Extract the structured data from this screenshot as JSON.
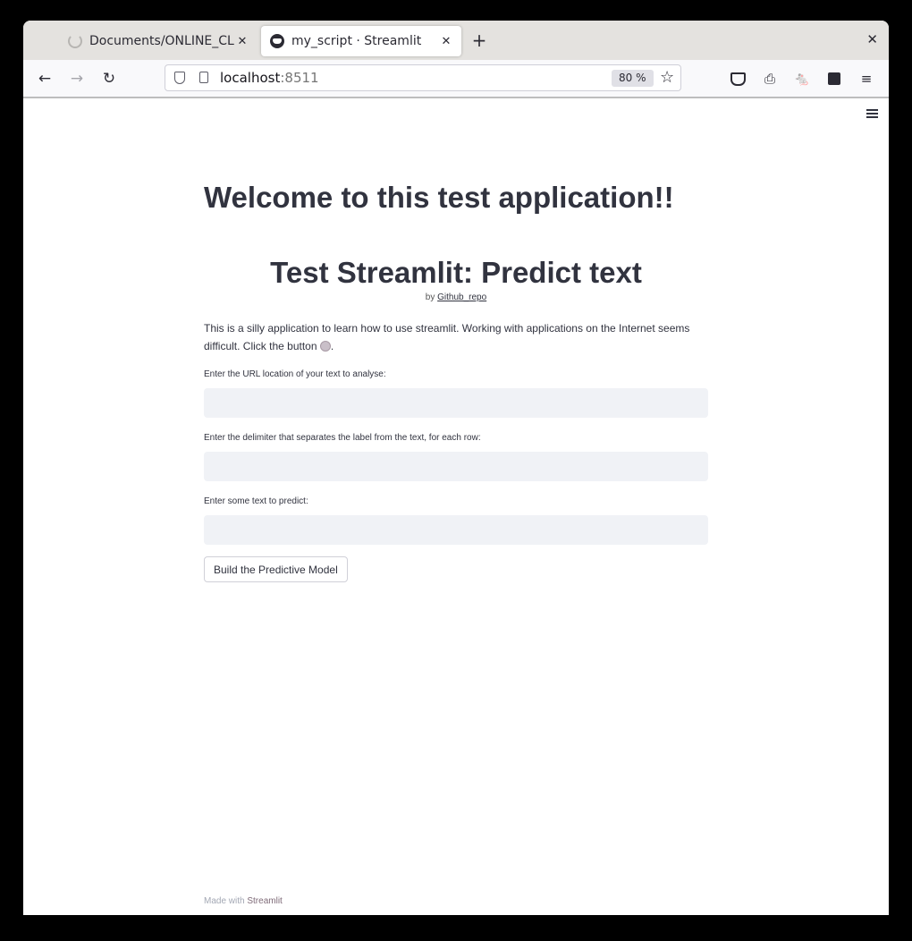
{
  "browser": {
    "tabs": [
      {
        "label": "Documents/ONLINE_CLA",
        "active": false,
        "loading": true
      },
      {
        "label": "my_script · Streamlit",
        "active": true
      }
    ],
    "new_tab_glyph": "+",
    "tab_close_glyph": "✕",
    "window_close_glyph": "✕",
    "url_host": "localhost",
    "url_port": ":8511",
    "zoom": "80 %"
  },
  "page": {
    "title": "Welcome to this test application!!",
    "subtitle": "Test Streamlit: Predict text",
    "byline_prefix": "by ",
    "byline_link": "Github_repo",
    "description": "This is a silly application to learn how to use streamlit. Working with applications on the Internet seems difficult. Click the button ",
    "description_end": ".",
    "fields": [
      {
        "label": "Enter the URL location of your text to analyse:",
        "value": ""
      },
      {
        "label": "Enter the delimiter that separates the label from the text, for each row:",
        "value": ""
      },
      {
        "label": "Enter some text to predict:",
        "value": ""
      }
    ],
    "button_label": "Build the Predictive Model",
    "footer_prefix": "Made with ",
    "footer_brand": "Streamlit"
  },
  "colors": {
    "text": "#31333f",
    "input_bg": "#f0f2f6",
    "tabstrip_bg": "#e4e2df"
  }
}
